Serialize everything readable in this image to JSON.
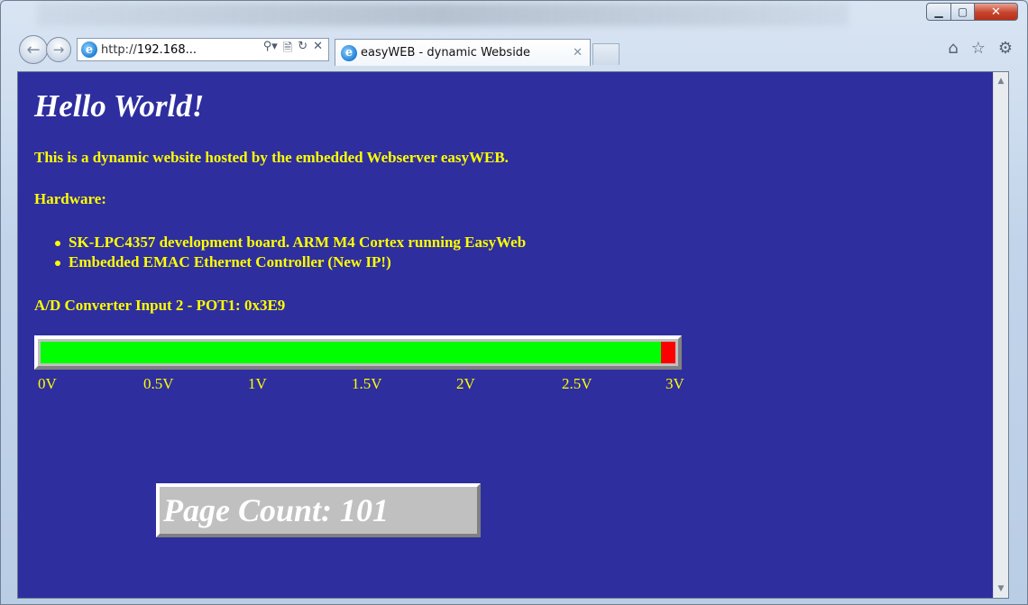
{
  "browser": {
    "address": {
      "url_prefix": "http://",
      "url_host": "192.168...",
      "search_glyph": "⚲▾",
      "compat_glyph": "🗎",
      "refresh_glyph": "↻",
      "stop_glyph": "✕"
    },
    "tab": {
      "title": "easyWEB - dynamic Webside",
      "close_glyph": "✕"
    },
    "nav": {
      "back_glyph": "←",
      "forward_glyph": "→"
    },
    "icons": [
      "home-icon",
      "favorites-star-icon",
      "tools-gear-icon"
    ],
    "window_controls": {
      "minimize": "▁",
      "maximize": "▢",
      "close": "✕"
    }
  },
  "page": {
    "heading": "Hello World!",
    "intro": "This is a dynamic website hosted by the embedded Webserver easyWEB.",
    "hardware_title": "Hardware:",
    "hardware_items": [
      "SK-LPC4357 development board. ARM M4 Cortex running EasyWeb",
      "Embedded EMAC Ethernet Controller (New IP!)"
    ],
    "adc_label": "A/D Converter Input 2 - POT1: 0x3E9",
    "adc_level_fraction": 0.977,
    "scale_ticks": [
      "0V",
      "0.5V",
      "1V",
      "1.5V",
      "2V",
      "2.5V",
      "3V"
    ],
    "page_count_text": "Page Count: 101"
  },
  "colors": {
    "page_background": "#2e2e9f",
    "text_yellow": "#ffff00",
    "heading_white": "#ffffff",
    "meter_fill": "#00ff00",
    "meter_empty": "#ff0000",
    "bevel_gray": "#c0c0c0"
  }
}
